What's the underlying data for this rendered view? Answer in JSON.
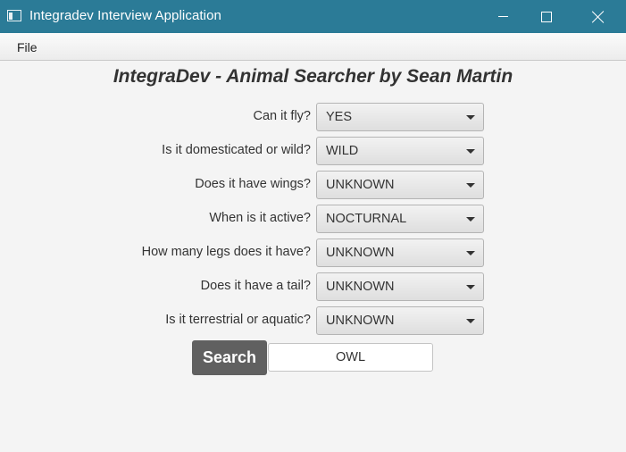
{
  "window": {
    "title": "Integradev Interview Application",
    "icon": "app-window-icon",
    "controls": [
      "minimize-icon",
      "maximize-icon",
      "close-icon"
    ]
  },
  "menu": {
    "file": "File"
  },
  "page": {
    "title": "IntegraDev - Animal Searcher by Sean Martin"
  },
  "questions": [
    {
      "label": "Can it fly?",
      "value": "YES"
    },
    {
      "label": "Is it domesticated or wild?",
      "value": "WILD"
    },
    {
      "label": "Does it have wings?",
      "value": "UNKNOWN"
    },
    {
      "label": "When is it active?",
      "value": "NOCTURNAL"
    },
    {
      "label": "How many legs does it have?",
      "value": "UNKNOWN"
    },
    {
      "label": "Does it have a tail?",
      "value": "UNKNOWN"
    },
    {
      "label": "Is it terrestrial or aquatic?",
      "value": "UNKNOWN"
    }
  ],
  "search": {
    "button_label": "Search",
    "result": "OWL"
  },
  "colors": {
    "titlebar": "#2b7b97",
    "search_button": "#606060",
    "text": "#333333"
  }
}
